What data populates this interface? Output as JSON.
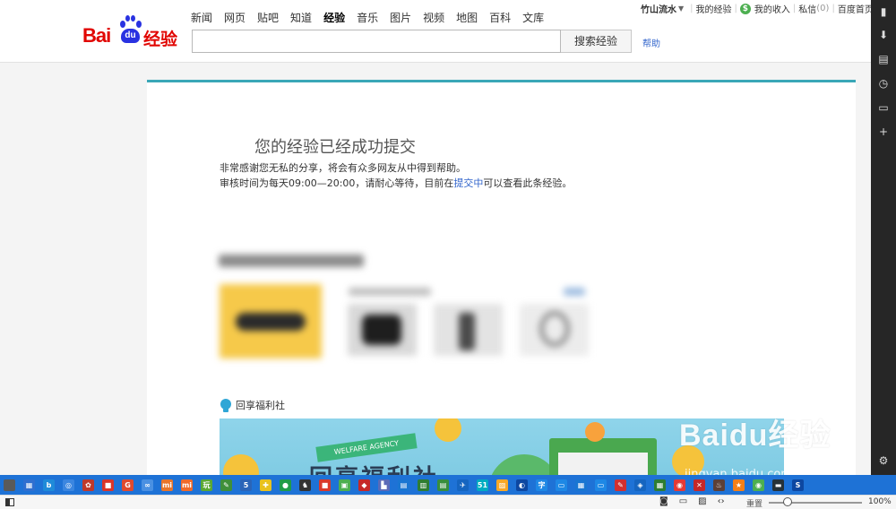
{
  "header": {
    "logo": {
      "bai": "Bai",
      "du": "du",
      "jingyan": "经验"
    },
    "nav": [
      "新闻",
      "网页",
      "贴吧",
      "知道",
      "经验",
      "音乐",
      "图片",
      "视频",
      "地图",
      "百科",
      "文库"
    ],
    "nav_active": "经验",
    "search": {
      "value": "",
      "button": "搜索经验"
    },
    "help": "帮助",
    "user": {
      "name": "竹山流水",
      "my_experience": "我的经验",
      "my_income": "我的收入",
      "messages": "私信",
      "messages_count": "(0)",
      "home": "百度首页",
      "separator": "|"
    }
  },
  "main": {
    "title": "您的经验已经成功提交",
    "line1": "非常感谢您无私的分享，将会有众多网友从中得到帮助。",
    "line2_pre": "审核时间为每天09:00—20:00，请耐心等待，目前在",
    "line2_link": "提交中",
    "line2_post": "可以查看此条经验。",
    "welfare_title": "回享福利社",
    "banner": {
      "ribbon": "WELFARE AGENCY",
      "title": "回享福利社"
    }
  },
  "watermark": {
    "brand": "Baidu经验",
    "url": "jingyan.baidu.com"
  },
  "statusbar": {
    "reset": "重置",
    "zoom": "100%"
  },
  "colors": {
    "accent": "#3aa7b7",
    "brand_red": "#e10602",
    "brand_blue": "#2932e1",
    "link": "#3366cc",
    "taskbar": "#1e72d6"
  },
  "sidebar_icons": [
    "download-icon",
    "notes-icon",
    "history-icon",
    "window-icon",
    "add-icon",
    "settings-icon"
  ],
  "taskbar_icons": [
    {
      "name": "app-icon-1",
      "color": "#5a5a5a",
      "glyph": ""
    },
    {
      "name": "app-icon-2",
      "color": "#2f6fd0",
      "glyph": "▦"
    },
    {
      "name": "bing-icon",
      "color": "#1f8bd9",
      "glyph": "b"
    },
    {
      "name": "app-icon-4",
      "color": "#3b86e0",
      "glyph": "◎"
    },
    {
      "name": "app-icon-5",
      "color": "#c0392b",
      "glyph": "✿"
    },
    {
      "name": "app-icon-6",
      "color": "#d9352a",
      "glyph": "■"
    },
    {
      "name": "app-icon-7",
      "color": "#e04a2f",
      "glyph": "G"
    },
    {
      "name": "app-icon-8",
      "color": "#4a90e2",
      "glyph": "∞"
    },
    {
      "name": "app-icon-9",
      "color": "#e8752a",
      "glyph": "mi"
    },
    {
      "name": "app-icon-10",
      "color": "#f06a2a",
      "glyph": "mi"
    },
    {
      "name": "app-icon-11",
      "color": "#5aa832",
      "glyph": "玩"
    },
    {
      "name": "app-icon-12",
      "color": "#3f8f3a",
      "glyph": "✎"
    },
    {
      "name": "app-icon-13",
      "color": "#2a64b8",
      "glyph": "5"
    },
    {
      "name": "app-icon-14",
      "color": "#e8c21e",
      "glyph": "✚"
    },
    {
      "name": "app-icon-15",
      "color": "#1f9c48",
      "glyph": "●"
    },
    {
      "name": "app-icon-16",
      "color": "#333333",
      "glyph": "♞"
    },
    {
      "name": "app-icon-17",
      "color": "#d93a2c",
      "glyph": "■"
    },
    {
      "name": "app-icon-18",
      "color": "#4caf50",
      "glyph": "▣"
    },
    {
      "name": "app-icon-19",
      "color": "#c62828",
      "glyph": "◆"
    },
    {
      "name": "app-icon-20",
      "color": "#5b6bb8",
      "glyph": "▙"
    },
    {
      "name": "app-icon-21",
      "color": "#1976d2",
      "glyph": "▤"
    },
    {
      "name": "app-icon-22",
      "color": "#2e7d32",
      "glyph": "▥"
    },
    {
      "name": "app-icon-23",
      "color": "#388e3c",
      "glyph": "▤"
    },
    {
      "name": "app-icon-24",
      "color": "#1565c0",
      "glyph": "✈"
    },
    {
      "name": "app-icon-25",
      "color": "#00acc1",
      "glyph": "51"
    },
    {
      "name": "app-icon-26",
      "color": "#f9a825",
      "glyph": "▨"
    },
    {
      "name": "app-icon-27",
      "color": "#0d47a1",
      "glyph": "◐"
    },
    {
      "name": "app-icon-28",
      "color": "#1e88e5",
      "glyph": "字"
    },
    {
      "name": "app-icon-29",
      "color": "#1e88e5",
      "glyph": "▭"
    },
    {
      "name": "app-icon-30",
      "color": "#1976d2",
      "glyph": "▦"
    },
    {
      "name": "app-icon-31",
      "color": "#1e88e5",
      "glyph": "▭"
    },
    {
      "name": "app-icon-32",
      "color": "#d32f2f",
      "glyph": "✎"
    },
    {
      "name": "app-icon-33",
      "color": "#1565c0",
      "glyph": "◈"
    },
    {
      "name": "app-icon-34",
      "color": "#2e7d32",
      "glyph": "▦"
    },
    {
      "name": "app-icon-35",
      "color": "#e53935",
      "glyph": "◉"
    },
    {
      "name": "app-icon-36",
      "color": "#c62828",
      "glyph": "✕"
    },
    {
      "name": "app-icon-37",
      "color": "#5d4037",
      "glyph": "♨"
    },
    {
      "name": "app-icon-38",
      "color": "#f57f17",
      "glyph": "★"
    },
    {
      "name": "app-icon-39",
      "color": "#4caf50",
      "glyph": "◉"
    },
    {
      "name": "app-icon-40",
      "color": "#263238",
      "glyph": "▬"
    },
    {
      "name": "app-icon-41",
      "color": "#0d47a1",
      "glyph": "S"
    }
  ]
}
